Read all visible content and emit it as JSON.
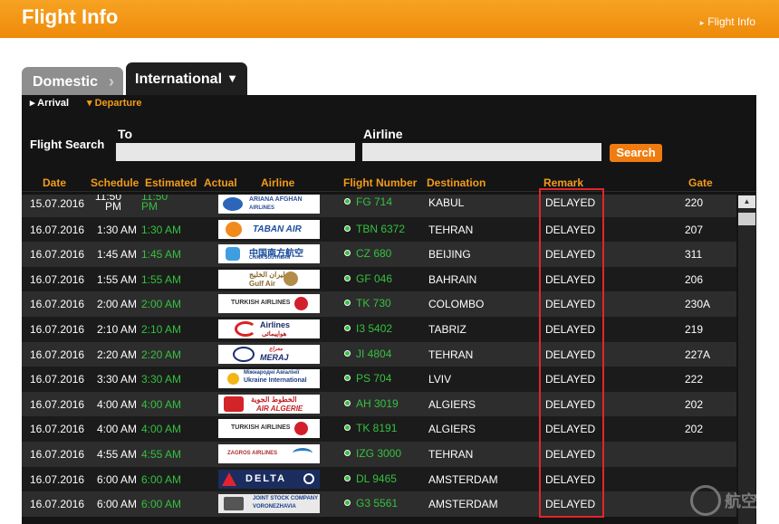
{
  "header": {
    "title": "Flight Info",
    "breadcrumb": "Flight Info"
  },
  "tabs": {
    "domestic": "Domestic",
    "international": "International"
  },
  "subtabs": {
    "arrival": "Arrival",
    "departure": "Departure"
  },
  "search": {
    "label": "Flight Search",
    "to_label": "To",
    "to_value": "",
    "airline_label": "Airline",
    "airline_value": "",
    "button": "Search"
  },
  "columns": {
    "date": "Date",
    "schedule": "Schedule",
    "estimated": "Estimated",
    "actual": "Actual",
    "airline": "Airline",
    "flight_number": "Flight Number",
    "destination": "Destination",
    "remark": "Remark",
    "gate": "Gate"
  },
  "colors": {
    "accent": "#f39c1a",
    "status_green": "#34c13f",
    "highlight": "#e0262c"
  },
  "flights": [
    {
      "date": "15.07.2016",
      "schedule": "11:50 PM",
      "estimated": "11:50 PM",
      "airline_logo": "ARIANA AFGHAN AIRLINES",
      "flight": "FG 714",
      "destination": "KABUL",
      "remark": "DELAYED",
      "gate": "220"
    },
    {
      "date": "16.07.2016",
      "schedule": "1:30 AM",
      "estimated": "1:30 AM",
      "airline_logo": "TABAN AIR",
      "flight": "TBN 6372",
      "destination": "TEHRAN",
      "remark": "DELAYED",
      "gate": "207"
    },
    {
      "date": "16.07.2016",
      "schedule": "1:45 AM",
      "estimated": "1:45 AM",
      "airline_logo": "中国南方航空",
      "flight": "CZ 680",
      "destination": "BEIJING",
      "remark": "DELAYED",
      "gate": "311"
    },
    {
      "date": "16.07.2016",
      "schedule": "1:55 AM",
      "estimated": "1:55 AM",
      "airline_logo": "Gulf Air",
      "flight": "GF 046",
      "destination": "BAHRAIN",
      "remark": "DELAYED",
      "gate": "206"
    },
    {
      "date": "16.07.2016",
      "schedule": "2:00 AM",
      "estimated": "2:00 AM",
      "airline_logo": "TURKISH AIRLINES",
      "flight": "TK 730",
      "destination": "COLOMBO",
      "remark": "DELAYED",
      "gate": "230A"
    },
    {
      "date": "16.07.2016",
      "schedule": "2:10 AM",
      "estimated": "2:10 AM",
      "airline_logo": "Airlines",
      "flight": "I3 5402",
      "destination": "TABRIZ",
      "remark": "DELAYED",
      "gate": "219"
    },
    {
      "date": "16.07.2016",
      "schedule": "2:20 AM",
      "estimated": "2:20 AM",
      "airline_logo": "MERAJ",
      "flight": "JI 4804",
      "destination": "TEHRAN",
      "remark": "DELAYED",
      "gate": "227A"
    },
    {
      "date": "16.07.2016",
      "schedule": "3:30 AM",
      "estimated": "3:30 AM",
      "airline_logo": "Ukraine International",
      "flight": "PS 704",
      "destination": "LVIV",
      "remark": "DELAYED",
      "gate": "222"
    },
    {
      "date": "16.07.2016",
      "schedule": "4:00 AM",
      "estimated": "4:00 AM",
      "airline_logo": "AIR ALGERIE",
      "flight": "AH 3019",
      "destination": "ALGIERS",
      "remark": "DELAYED",
      "gate": "202"
    },
    {
      "date": "16.07.2016",
      "schedule": "4:00 AM",
      "estimated": "4:00 AM",
      "airline_logo": "TURKISH AIRLINES",
      "flight": "TK 8191",
      "destination": "ALGIERS",
      "remark": "DELAYED",
      "gate": "202"
    },
    {
      "date": "16.07.2016",
      "schedule": "4:55 AM",
      "estimated": "4:55 AM",
      "airline_logo": "ZAGROS AIRLINES",
      "flight": "IZG 3000",
      "destination": "TEHRAN",
      "remark": "DELAYED",
      "gate": ""
    },
    {
      "date": "16.07.2016",
      "schedule": "6:00 AM",
      "estimated": "6:00 AM",
      "airline_logo": "DELTA",
      "flight": "DL 9465",
      "destination": "AMSTERDAM",
      "remark": "DELAYED",
      "gate": ""
    },
    {
      "date": "16.07.2016",
      "schedule": "6:00 AM",
      "estimated": "6:00 AM",
      "airline_logo": "JOINT STOCK COMPANY VORONEZHAVIA",
      "flight": "G3 5561",
      "destination": "AMSTERDAM",
      "remark": "DELAYED",
      "gate": ""
    }
  ],
  "watermark": "航空"
}
